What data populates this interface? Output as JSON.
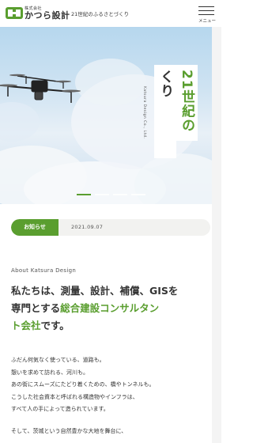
{
  "header": {
    "logo_small": "株式会社",
    "logo_name": "かつら設計",
    "tagline": "21世紀のふるさとづくり",
    "menu_label": "メニュー"
  },
  "hero": {
    "caption_green": "21世紀の",
    "caption_dark": "ふるさとづくり",
    "side_text": "Katsura Design Co., Ltd.",
    "slides_total": 4,
    "slide_active": 1
  },
  "news": {
    "badge": "お知らせ",
    "date": "2021.09.07"
  },
  "about": {
    "label": "About Katsura Design",
    "heading_line1": "私たちは、測量、設計、補償、GISを",
    "heading_line2_prefix": "専門とする",
    "heading_line2_green": "総合建設コンサルタン",
    "heading_line3_green": "ト会社",
    "heading_line3_suffix": "です。",
    "body": [
      "ふだん何気なく使っている、道路も。",
      "憩いを求めて訪れる、河川も。",
      "あの街にスムーズにたどり着くための、橋やトンネルも。",
      "こうした社会資本と呼ばれる構造物やインフラは、",
      "すべて人の手によって造られています。"
    ],
    "more": "そして、茨城という自然豊かな大地を舞台に、"
  },
  "colors": {
    "accent": "#5a9e2f",
    "text": "#333333",
    "news_bg": "#f2f2f0"
  },
  "icons": {
    "menu": "hamburger-icon",
    "logo": "katsura-logo-mark"
  }
}
